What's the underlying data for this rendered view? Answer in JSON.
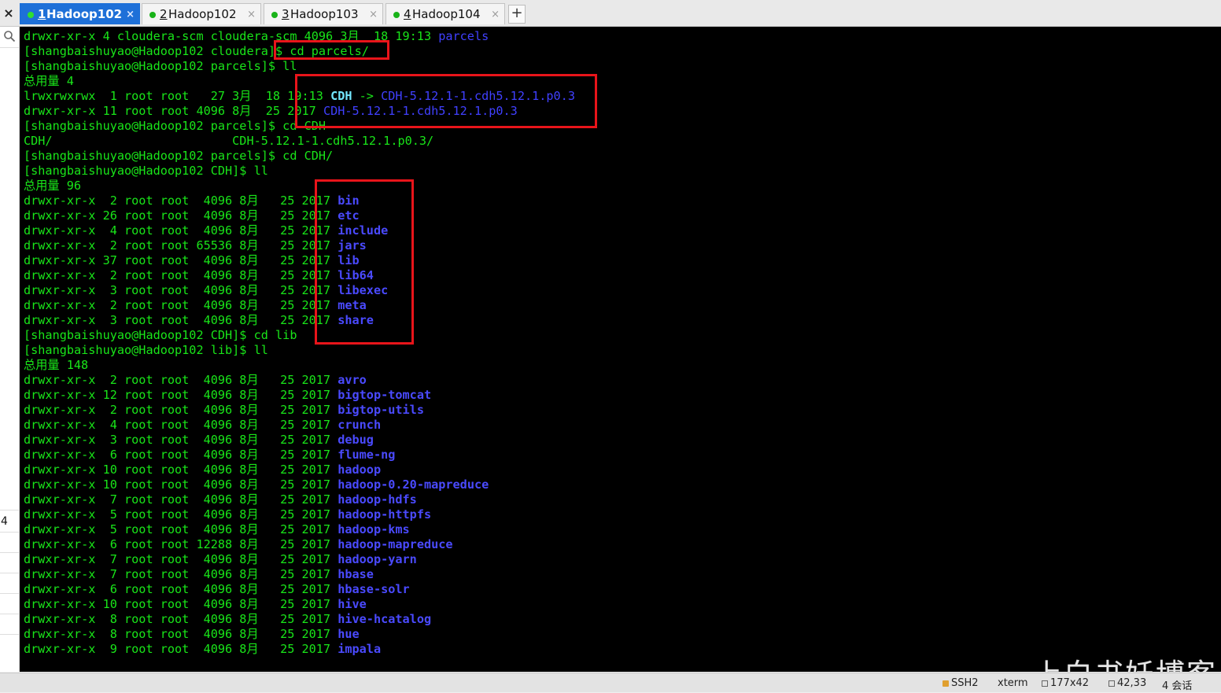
{
  "tabs": [
    {
      "number": "1",
      "label": "Hadoop102",
      "close": "×"
    },
    {
      "number": "2",
      "label": "Hadoop102",
      "close": "×"
    },
    {
      "number": "3",
      "label": "Hadoop103",
      "close": "×"
    },
    {
      "number": "4",
      "label": "Hadoop104",
      "close": "×"
    }
  ],
  "tabbar": {
    "close_label": "×",
    "add_label": "+"
  },
  "left_strip": {
    "row_number": "4"
  },
  "terminal": {
    "lines": [
      [
        {
          "t": "drwxr-xr-x 4 cloudera-scm cloudera-scm 4096 3月  18 19:13 ",
          "c": "c-g"
        },
        {
          "t": "parcels",
          "c": "c-b"
        }
      ],
      [
        {
          "t": "[shangbaishuyao@Hadoop102 cloudera]$ cd parcels/",
          "c": "c-g"
        }
      ],
      [
        {
          "t": "[shangbaishuyao@Hadoop102 parcels]$ ll",
          "c": "c-g"
        }
      ],
      [
        {
          "t": "总用量 4",
          "c": "c-g"
        }
      ],
      [
        {
          "t": "lrwxrwxrwx  1 root root   27 3月  18 19:13 ",
          "c": "c-g"
        },
        {
          "t": "CDH",
          "c": "c-cy"
        },
        {
          "t": " -> ",
          "c": "c-g"
        },
        {
          "t": "CDH-5.12.1-1.cdh5.12.1.p0.3",
          "c": "c-b"
        }
      ],
      [
        {
          "t": "drwxr-xr-x 11 root root 4096 8月  25 2017 ",
          "c": "c-g"
        },
        {
          "t": "CDH-5.12.1-1.cdh5.12.1.p0.3",
          "c": "c-b"
        }
      ],
      [
        {
          "t": "[shangbaishuyao@Hadoop102 parcels]$ cd CDH",
          "c": "c-g"
        }
      ],
      [
        {
          "t": "CDH/                         CDH-5.12.1-1.cdh5.12.1.p0.3/",
          "c": "c-g"
        }
      ],
      [
        {
          "t": "[shangbaishuyao@Hadoop102 parcels]$ cd CDH/",
          "c": "c-g"
        }
      ],
      [
        {
          "t": "[shangbaishuyao@Hadoop102 CDH]$ ll",
          "c": "c-g"
        }
      ],
      [
        {
          "t": "总用量 96",
          "c": "c-g"
        }
      ],
      [
        {
          "t": "drwxr-xr-x  2 root root  4096 8月   25 2017 ",
          "c": "c-g"
        },
        {
          "t": "bin",
          "c": "c-bb"
        }
      ],
      [
        {
          "t": "drwxr-xr-x 26 root root  4096 8月   25 2017 ",
          "c": "c-g"
        },
        {
          "t": "etc",
          "c": "c-bb"
        }
      ],
      [
        {
          "t": "drwxr-xr-x  4 root root  4096 8月   25 2017 ",
          "c": "c-g"
        },
        {
          "t": "include",
          "c": "c-bb"
        }
      ],
      [
        {
          "t": "drwxr-xr-x  2 root root 65536 8月   25 2017 ",
          "c": "c-g"
        },
        {
          "t": "jars",
          "c": "c-bb"
        }
      ],
      [
        {
          "t": "drwxr-xr-x 37 root root  4096 8月   25 2017 ",
          "c": "c-g"
        },
        {
          "t": "lib",
          "c": "c-bb"
        }
      ],
      [
        {
          "t": "drwxr-xr-x  2 root root  4096 8月   25 2017 ",
          "c": "c-g"
        },
        {
          "t": "lib64",
          "c": "c-bb"
        }
      ],
      [
        {
          "t": "drwxr-xr-x  3 root root  4096 8月   25 2017 ",
          "c": "c-g"
        },
        {
          "t": "libexec",
          "c": "c-bb"
        }
      ],
      [
        {
          "t": "drwxr-xr-x  2 root root  4096 8月   25 2017 ",
          "c": "c-g"
        },
        {
          "t": "meta",
          "c": "c-bb"
        }
      ],
      [
        {
          "t": "drwxr-xr-x  3 root root  4096 8月   25 2017 ",
          "c": "c-g"
        },
        {
          "t": "share",
          "c": "c-bb"
        }
      ],
      [
        {
          "t": "[shangbaishuyao@Hadoop102 CDH]$ cd lib",
          "c": "c-g"
        }
      ],
      [
        {
          "t": "[shangbaishuyao@Hadoop102 lib]$ ll",
          "c": "c-g"
        }
      ],
      [
        {
          "t": "总用量 148",
          "c": "c-g"
        }
      ],
      [
        {
          "t": "drwxr-xr-x  2 root root  4096 8月   25 2017 ",
          "c": "c-g"
        },
        {
          "t": "avro",
          "c": "c-bb"
        }
      ],
      [
        {
          "t": "drwxr-xr-x 12 root root  4096 8月   25 2017 ",
          "c": "c-g"
        },
        {
          "t": "bigtop-tomcat",
          "c": "c-bb"
        }
      ],
      [
        {
          "t": "drwxr-xr-x  2 root root  4096 8月   25 2017 ",
          "c": "c-g"
        },
        {
          "t": "bigtop-utils",
          "c": "c-bb"
        }
      ],
      [
        {
          "t": "drwxr-xr-x  4 root root  4096 8月   25 2017 ",
          "c": "c-g"
        },
        {
          "t": "crunch",
          "c": "c-bb"
        }
      ],
      [
        {
          "t": "drwxr-xr-x  3 root root  4096 8月   25 2017 ",
          "c": "c-g"
        },
        {
          "t": "debug",
          "c": "c-bb"
        }
      ],
      [
        {
          "t": "drwxr-xr-x  6 root root  4096 8月   25 2017 ",
          "c": "c-g"
        },
        {
          "t": "flume-ng",
          "c": "c-bb"
        }
      ],
      [
        {
          "t": "drwxr-xr-x 10 root root  4096 8月   25 2017 ",
          "c": "c-g"
        },
        {
          "t": "hadoop",
          "c": "c-bb"
        }
      ],
      [
        {
          "t": "drwxr-xr-x 10 root root  4096 8月   25 2017 ",
          "c": "c-g"
        },
        {
          "t": "hadoop-0.20-mapreduce",
          "c": "c-bb"
        }
      ],
      [
        {
          "t": "drwxr-xr-x  7 root root  4096 8月   25 2017 ",
          "c": "c-g"
        },
        {
          "t": "hadoop-hdfs",
          "c": "c-bb"
        }
      ],
      [
        {
          "t": "drwxr-xr-x  5 root root  4096 8月   25 2017 ",
          "c": "c-g"
        },
        {
          "t": "hadoop-httpfs",
          "c": "c-bb"
        }
      ],
      [
        {
          "t": "drwxr-xr-x  5 root root  4096 8月   25 2017 ",
          "c": "c-g"
        },
        {
          "t": "hadoop-kms",
          "c": "c-bb"
        }
      ],
      [
        {
          "t": "drwxr-xr-x  6 root root 12288 8月   25 2017 ",
          "c": "c-g"
        },
        {
          "t": "hadoop-mapreduce",
          "c": "c-bb"
        }
      ],
      [
        {
          "t": "drwxr-xr-x  7 root root  4096 8月   25 2017 ",
          "c": "c-g"
        },
        {
          "t": "hadoop-yarn",
          "c": "c-bb"
        }
      ],
      [
        {
          "t": "drwxr-xr-x  7 root root  4096 8月   25 2017 ",
          "c": "c-g"
        },
        {
          "t": "hbase",
          "c": "c-bb"
        }
      ],
      [
        {
          "t": "drwxr-xr-x  6 root root  4096 8月   25 2017 ",
          "c": "c-g"
        },
        {
          "t": "hbase-solr",
          "c": "c-bb"
        }
      ],
      [
        {
          "t": "drwxr-xr-x 10 root root  4096 8月   25 2017 ",
          "c": "c-g"
        },
        {
          "t": "hive",
          "c": "c-bb"
        }
      ],
      [
        {
          "t": "drwxr-xr-x  8 root root  4096 8月   25 2017 ",
          "c": "c-g"
        },
        {
          "t": "hive-hcatalog",
          "c": "c-bb"
        }
      ],
      [
        {
          "t": "drwxr-xr-x  8 root root  4096 8月   25 2017 ",
          "c": "c-g"
        },
        {
          "t": "hue",
          "c": "c-bb"
        }
      ],
      [
        {
          "t": "drwxr-xr-x  9 root root  4096 8月   25 2017 ",
          "c": "c-g"
        },
        {
          "t": "impala",
          "c": "c-bb"
        }
      ]
    ]
  },
  "statusbar": {
    "protocol": "SSH2",
    "term_type": "xterm",
    "size": "177x42",
    "cursor": "42,33",
    "sessions": "4 会话"
  },
  "watermark": "上白书妖博客",
  "colors": {
    "terminal_bg": "#000000",
    "text_green": "#19e519",
    "dir_blue": "#4a4aff",
    "symlink_cyan": "#74e8ff",
    "highlight_red": "#e8141a",
    "active_tab": "#1e70d8"
  }
}
